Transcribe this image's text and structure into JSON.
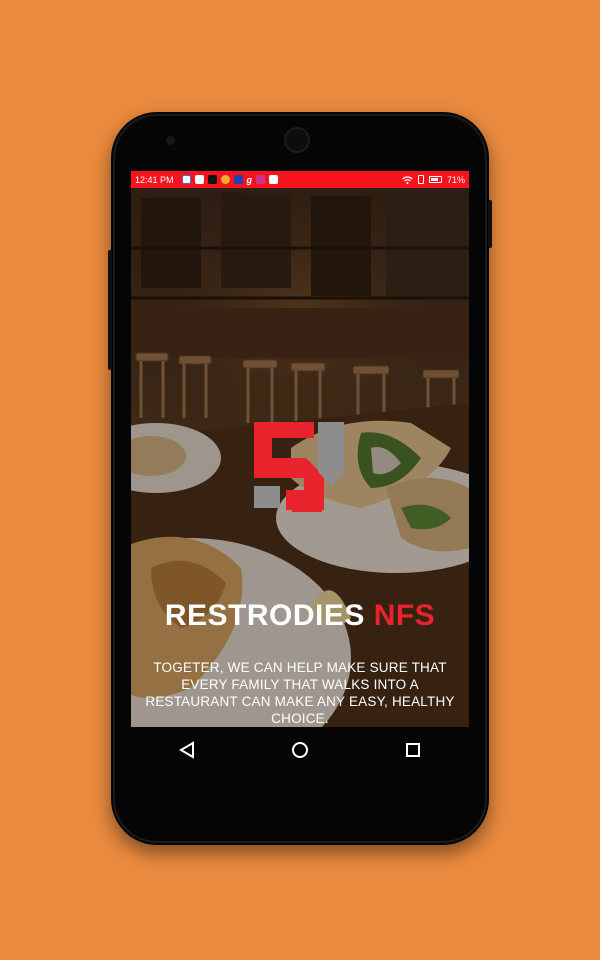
{
  "status_bar": {
    "time": "12:41 PM",
    "battery": "71%",
    "notification_icons": [
      "mail-icon",
      "gallery-icon",
      "tiktok-icon",
      "app-icon",
      "jio-icon",
      "g-icon",
      "instagram-icon",
      "gmail-icon"
    ],
    "background_color": "#F5141E"
  },
  "brand": {
    "name_primary": "RESTRODIES",
    "name_accent": "NFS",
    "accent_color": "#E8232B"
  },
  "tagline": "TOGETER, WE CAN HELP MAKE SURE THAT EVERY FAMILY THAT WALKS INTO A RESTAURANT CAN MAKE ANY EASY, HEALTHY CHOICE.",
  "navigation": {
    "back_icon": "back-triangle-icon",
    "home_icon": "home-circle-icon",
    "recents_icon": "recents-square-icon"
  },
  "colors": {
    "page_background": "#EA8A3E",
    "phone_body": "#050505"
  }
}
